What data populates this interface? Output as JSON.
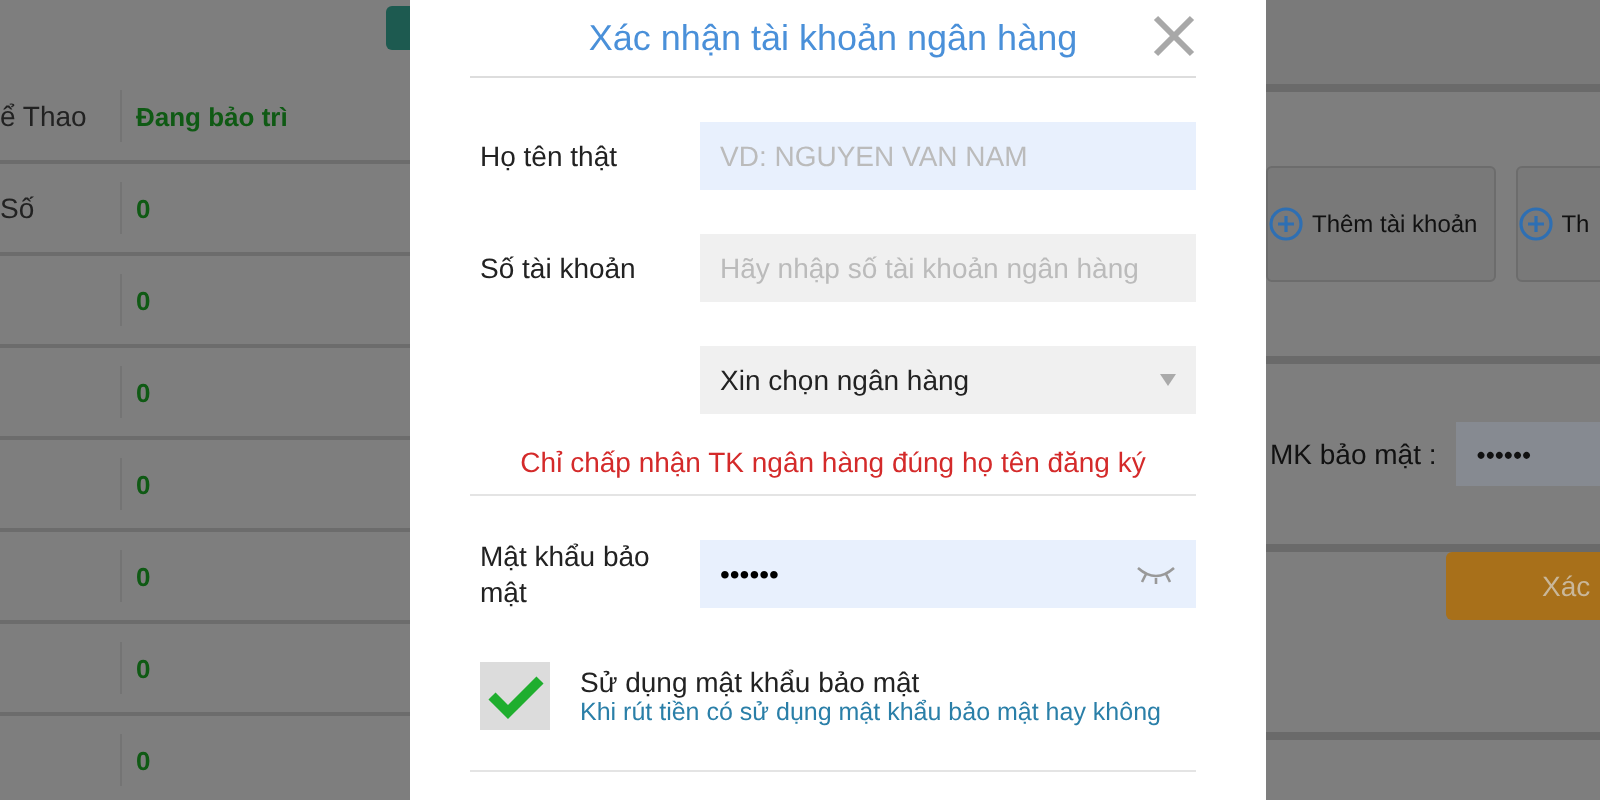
{
  "background_table": {
    "header": {
      "column_1": "ể Thao",
      "column_2": "Đang bảo trì"
    },
    "rows": [
      {
        "column_1": "Số",
        "column_2": "0"
      },
      {
        "column_2": "0"
      },
      {
        "column_2": "0"
      },
      {
        "column_2": "0"
      },
      {
        "column_2": "0"
      },
      {
        "column_2": "0"
      },
      {
        "column_2": "0"
      }
    ]
  },
  "dialog": {
    "title": "Xác nhận tài khoản ngân hàng",
    "fields": [
      {
        "kind": "text",
        "label": "Họ tên thật",
        "placeholder": "VD: NGUYEN VAN NAM",
        "focused": true
      },
      {
        "kind": "text",
        "label": "Số tài khoản",
        "placeholder": "Hãy nhập số tài khoản ngân hàng",
        "focused": false
      },
      {
        "kind": "select",
        "value": "Xin chọn ngân hàng",
        "focused": false
      }
    ],
    "notice": "Chỉ chấp nhận TK ngân hàng đúng họ tên đăng ký",
    "password": {
      "label": "Mật khẩu bảo mật",
      "value": "••••••"
    },
    "option": {
      "checked": true,
      "label": "Sử dụng mật khẩu bảo mật",
      "hint": "Khi rút tiền có sử dụng mật khẩu bảo mật hay không"
    }
  },
  "background_panel": {
    "buttons": [
      "Thêm tài khoản",
      "Th"
    ],
    "password_label": "MK bảo mật :",
    "password_value": "••••••",
    "confirm_button": "Xác"
  }
}
